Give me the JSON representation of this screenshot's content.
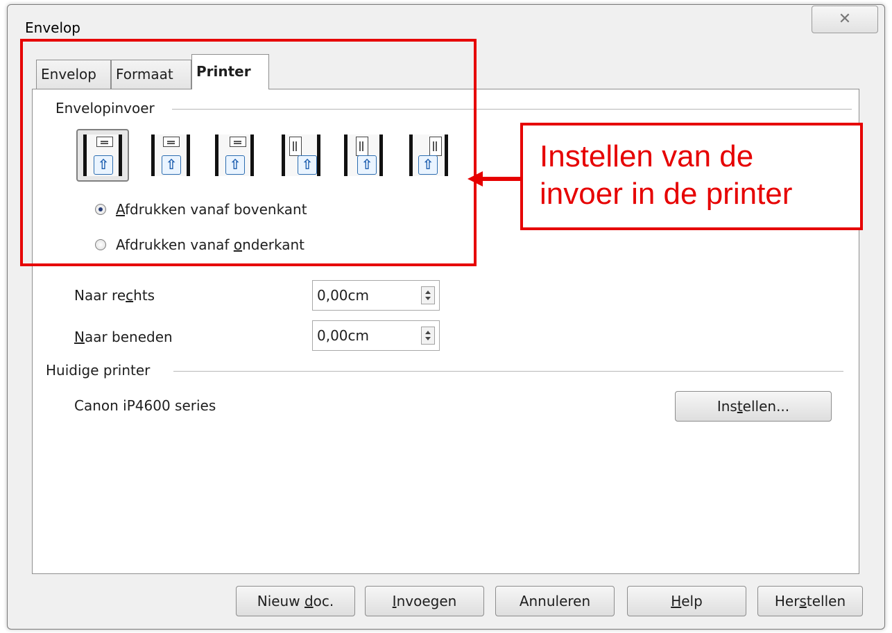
{
  "window": {
    "title": "Envelop",
    "close_glyph": "✕"
  },
  "tabs": [
    {
      "label": "Envelop"
    },
    {
      "label": "Formaat"
    },
    {
      "label": "Printer",
      "active": true
    }
  ],
  "feed_section": {
    "label": "Envelopinvoer",
    "options": [
      {
        "icon": "envelope-feed-horizontal-left-icon",
        "selected": true
      },
      {
        "icon": "envelope-feed-horizontal-center-icon"
      },
      {
        "icon": "envelope-feed-horizontal-right-icon"
      },
      {
        "icon": "envelope-feed-vertical-left-icon"
      },
      {
        "icon": "envelope-feed-vertical-center-icon"
      },
      {
        "icon": "envelope-feed-vertical-right-icon"
      }
    ],
    "radio_top": {
      "pre": "",
      "accel": "A",
      "post": "fdrukken vanaf bovenkant",
      "checked": true
    },
    "radio_bottom": {
      "pre": "Afdrukken vanaf ",
      "accel": "o",
      "post": "nderkant",
      "checked": false
    }
  },
  "offsets": {
    "right": {
      "label_pre": "Naar re",
      "label_accel": "c",
      "label_post": "hts",
      "value": "0,00cm"
    },
    "down": {
      "label_pre": "",
      "label_accel": "N",
      "label_post": "aar beneden",
      "value": "0,00cm"
    }
  },
  "printer_section": {
    "label": "Huidige printer",
    "printer_name": "Canon iP4600 series",
    "setup_button": {
      "pre": "Ins",
      "accel": "t",
      "post": "ellen..."
    }
  },
  "footer_buttons": {
    "new_doc": {
      "pre": "Nieuw ",
      "accel": "d",
      "post": "oc."
    },
    "insert": {
      "pre": "",
      "accel": "I",
      "post": "nvoegen"
    },
    "cancel": {
      "label": "Annuleren"
    },
    "help": {
      "pre": "",
      "accel": "H",
      "post": "elp"
    },
    "reset": {
      "pre": "Her",
      "accel": "s",
      "post": "tellen"
    }
  },
  "annotation": {
    "line1": "Instellen van de",
    "line2": "invoer in de printer",
    "color": "#e60000"
  }
}
